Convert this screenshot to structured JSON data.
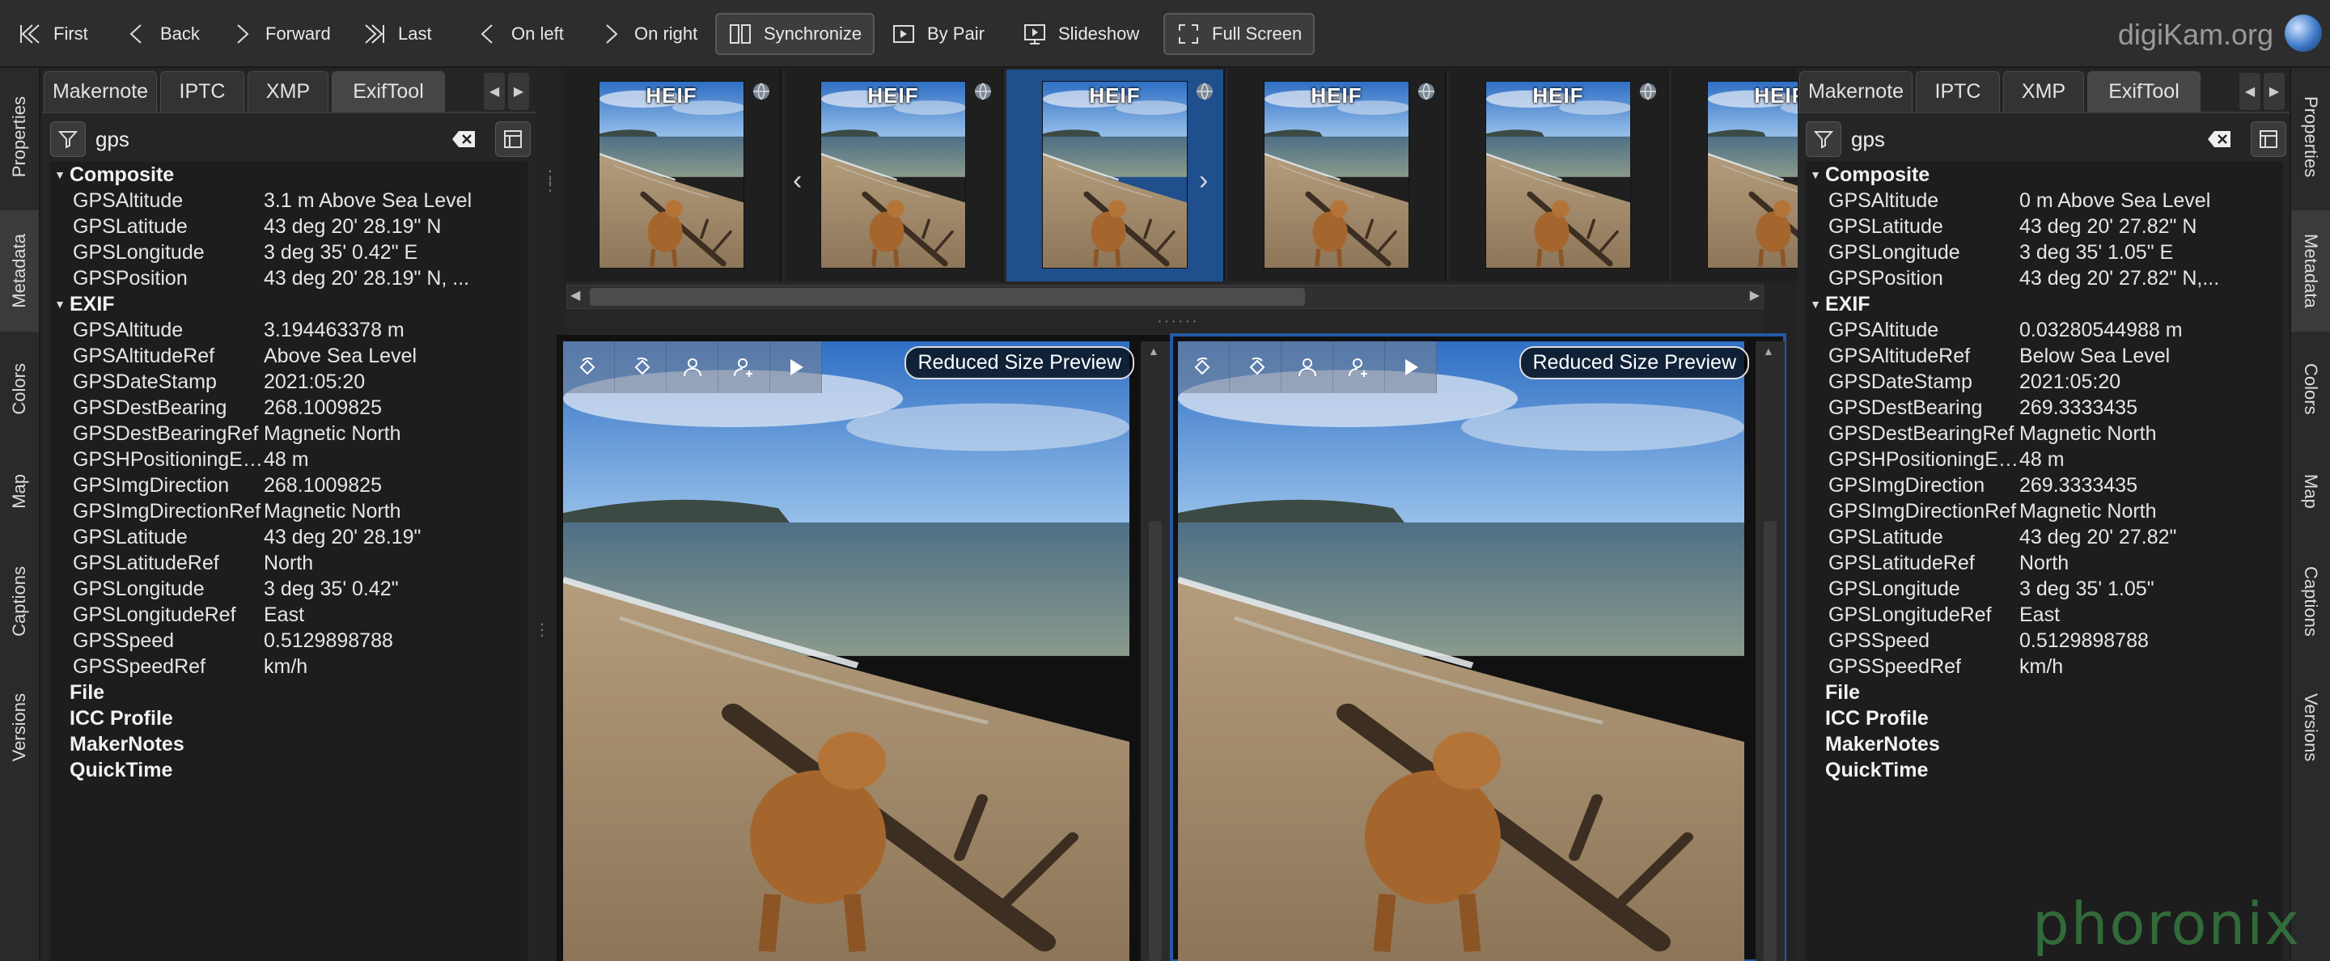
{
  "toolbar": {
    "first": "First",
    "back": "Back",
    "forward": "Forward",
    "last": "Last",
    "on_left": "On left",
    "on_right": "On right",
    "synchronize": "Synchronize",
    "by_pair": "By Pair",
    "slideshow": "Slideshow",
    "full_screen": "Full Screen"
  },
  "brand": "digiKam.org",
  "left_strip": [
    "Properties",
    "Metadata",
    "Colors",
    "Map",
    "Captions",
    "Versions"
  ],
  "right_strip": [
    "Properties",
    "Metadata",
    "Colors",
    "Map",
    "Captions",
    "Versions"
  ],
  "tabs": [
    "Makernote",
    "IPTC",
    "XMP",
    "ExifTool"
  ],
  "left_panel": {
    "search": "gps",
    "composite_label": "Composite",
    "composite": [
      {
        "k": "GPSAltitude",
        "v": "3.1 m Above Sea Level"
      },
      {
        "k": "GPSLatitude",
        "v": "43 deg 20' 28.19\" N"
      },
      {
        "k": "GPSLongitude",
        "v": "3 deg 35' 0.42\" E"
      },
      {
        "k": "GPSPosition",
        "v": "43 deg 20' 28.19\" N, ..."
      }
    ],
    "exif_label": "EXIF",
    "exif": [
      {
        "k": "GPSAltitude",
        "v": "3.194463378 m"
      },
      {
        "k": "GPSAltitudeRef",
        "v": "Above Sea Level"
      },
      {
        "k": "GPSDateStamp",
        "v": "2021:05:20"
      },
      {
        "k": "GPSDestBearing",
        "v": "268.1009825"
      },
      {
        "k": "GPSDestBearingRef",
        "v": "Magnetic North"
      },
      {
        "k": "GPSHPositioningEr...",
        "v": "48 m"
      },
      {
        "k": "GPSImgDirection",
        "v": "268.1009825"
      },
      {
        "k": "GPSImgDirectionRef",
        "v": "Magnetic North"
      },
      {
        "k": "GPSLatitude",
        "v": "43 deg 20' 28.19\""
      },
      {
        "k": "GPSLatitudeRef",
        "v": "North"
      },
      {
        "k": "GPSLongitude",
        "v": "3 deg 35' 0.42\""
      },
      {
        "k": "GPSLongitudeRef",
        "v": "East"
      },
      {
        "k": "GPSSpeed",
        "v": "0.5129898788"
      },
      {
        "k": "GPSSpeedRef",
        "v": "km/h"
      }
    ],
    "groups": [
      "File",
      "ICC Profile",
      "MakerNotes",
      "QuickTime"
    ]
  },
  "right_panel": {
    "search": "gps",
    "composite_label": "Composite",
    "composite": [
      {
        "k": "GPSAltitude",
        "v": "0 m Above Sea Level"
      },
      {
        "k": "GPSLatitude",
        "v": "43 deg 20' 27.82\" N"
      },
      {
        "k": "GPSLongitude",
        "v": "3 deg 35' 1.05\" E"
      },
      {
        "k": "GPSPosition",
        "v": "43 deg 20' 27.82\" N,..."
      }
    ],
    "exif_label": "EXIF",
    "exif": [
      {
        "k": "GPSAltitude",
        "v": "0.03280544988 m"
      },
      {
        "k": "GPSAltitudeRef",
        "v": "Below Sea Level"
      },
      {
        "k": "GPSDateStamp",
        "v": "2021:05:20"
      },
      {
        "k": "GPSDestBearing",
        "v": "269.3333435"
      },
      {
        "k": "GPSDestBearingRef",
        "v": "Magnetic North"
      },
      {
        "k": "GPSHPositioningEr...",
        "v": "48 m"
      },
      {
        "k": "GPSImgDirection",
        "v": "269.3333435"
      },
      {
        "k": "GPSImgDirectionRef",
        "v": "Magnetic North"
      },
      {
        "k": "GPSLatitude",
        "v": "43 deg 20' 27.82\""
      },
      {
        "k": "GPSLatitudeRef",
        "v": "North"
      },
      {
        "k": "GPSLongitude",
        "v": "3 deg 35' 1.05\""
      },
      {
        "k": "GPSLongitudeRef",
        "v": "East"
      },
      {
        "k": "GPSSpeed",
        "v": "0.5129898788"
      },
      {
        "k": "GPSSpeedRef",
        "v": "km/h"
      }
    ],
    "groups": [
      "File",
      "ICC Profile",
      "MakerNotes",
      "QuickTime"
    ]
  },
  "thumbnails": {
    "badge": "HEIF",
    "selected_index": 2
  },
  "preview": {
    "left_label": "Reduced Size Preview",
    "right_label": "Reduced Size Preview"
  },
  "watermark": "phoronix"
}
